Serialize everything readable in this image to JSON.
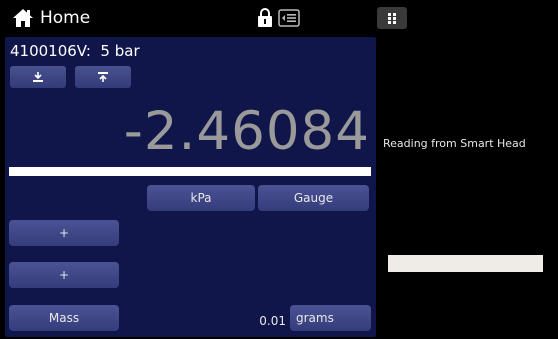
{
  "topbar": {
    "home_label": "Home",
    "icons": {
      "home": "home-icon",
      "lock": "lock-icon",
      "display": "display-settings-icon",
      "menu": "grid-menu-icon"
    }
  },
  "channel": {
    "title": "4100106V:  5 bar",
    "zero_button_icon": "zero-arrow-icon",
    "tare_button_icon": "tare-arrow-icon",
    "reading": "-2.46084",
    "units_label": "kPa",
    "mode_label": "Gauge",
    "add_label_1": "+",
    "add_label_2": "+",
    "mass_label": "Mass",
    "resolution_value": "0.01",
    "mass_unit_label": "grams"
  },
  "side": {
    "reading_source": "Reading from Smart Head"
  },
  "colors": {
    "panel_bg": "#11164a",
    "button_top": "#4c5394",
    "button_bottom": "#343c7c",
    "reading_text": "#9a9a9a",
    "side_bar": "#efebe6"
  }
}
